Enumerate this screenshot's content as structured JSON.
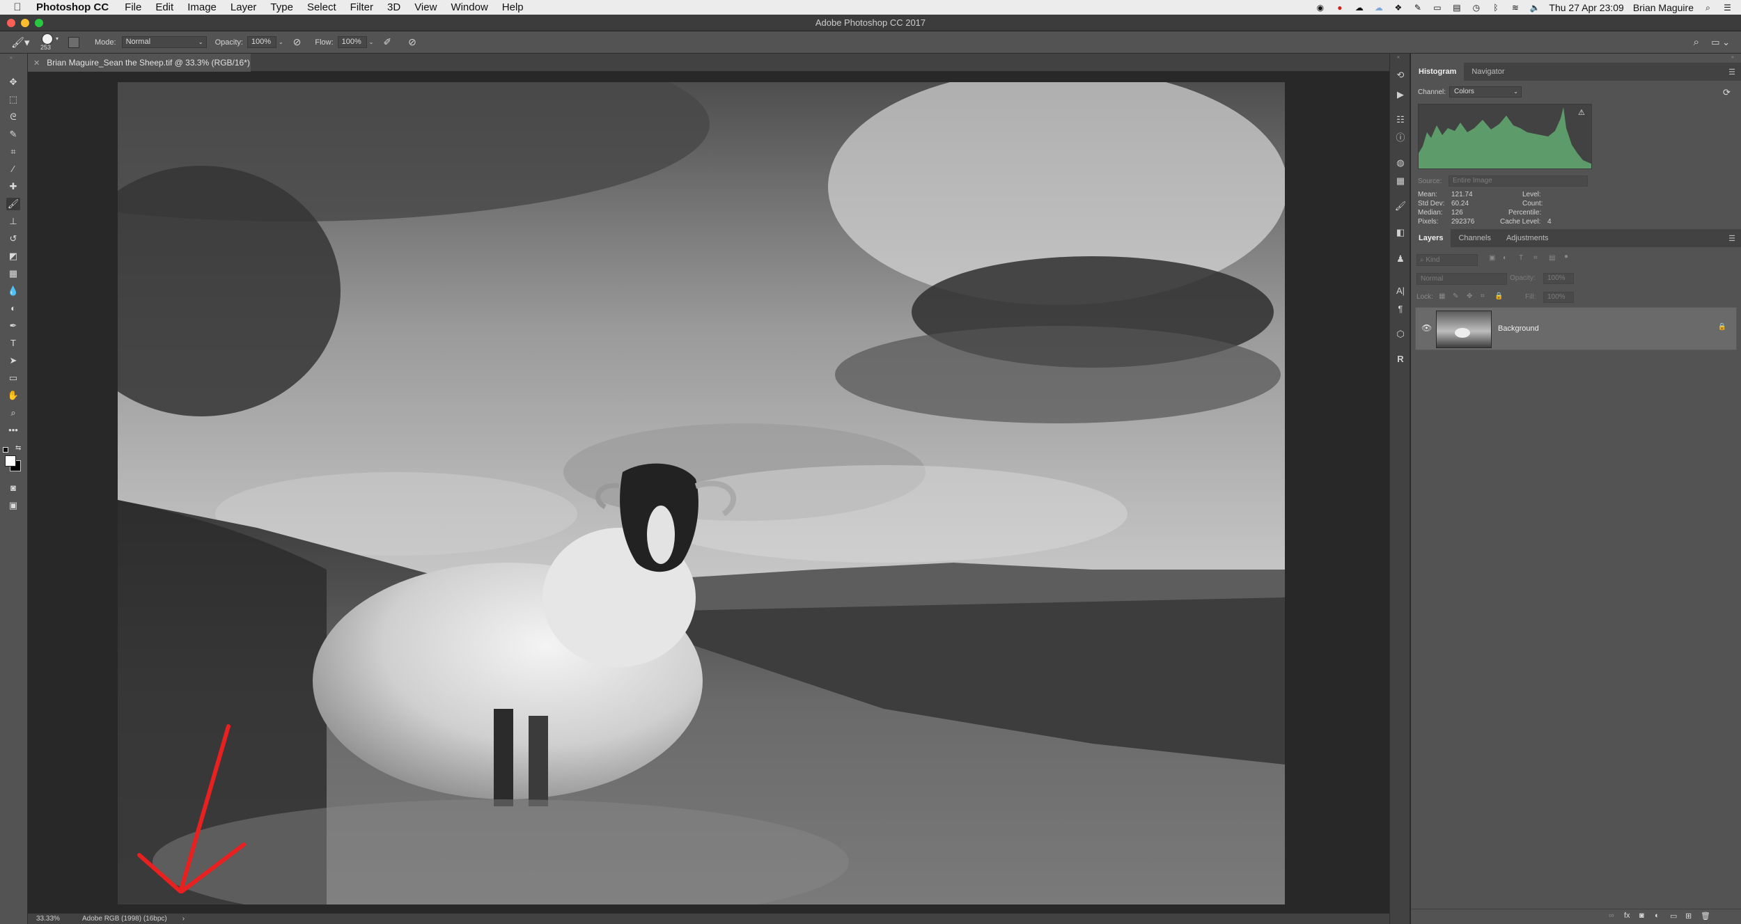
{
  "menubar": {
    "app_name": "Photoshop CC",
    "items": [
      "File",
      "Edit",
      "Image",
      "Layer",
      "Type",
      "Select",
      "Filter",
      "3D",
      "View",
      "Window",
      "Help"
    ],
    "clock": "Thu 27 Apr  23:09",
    "user": "Brian Maguire"
  },
  "window": {
    "title": "Adobe Photoshop CC 2017",
    "traffic_colors": [
      "#fc5f57",
      "#fdbc2e",
      "#28c840"
    ]
  },
  "options": {
    "brush_size": "253",
    "mode_label": "Mode:",
    "mode_value": "Normal",
    "opacity_label": "Opacity:",
    "opacity_value": "100%",
    "flow_label": "Flow:",
    "flow_value": "100%"
  },
  "document": {
    "tab_title": "Brian Maguire_Sean the Sheep.tif @ 33.3% (RGB/16*)",
    "zoom": "33.33%",
    "profile": "Adobe RGB (1998) (16bpc)",
    "status_arrow": "›"
  },
  "histogram": {
    "tabs": [
      "Histogram",
      "Navigator"
    ],
    "channel_label": "Channel:",
    "channel_value": "Colors",
    "source_label": "Source:",
    "source_value": "Entire Image",
    "stats_left": [
      {
        "label": "Mean:",
        "value": "121.74"
      },
      {
        "label": "Std Dev:",
        "value": "60.24"
      },
      {
        "label": "Median:",
        "value": "126"
      },
      {
        "label": "Pixels:",
        "value": "292376"
      }
    ],
    "stats_right": [
      {
        "label": "Level:",
        "value": ""
      },
      {
        "label": "Count:",
        "value": ""
      },
      {
        "label": "Percentile:",
        "value": ""
      },
      {
        "label": "Cache Level:",
        "value": "4"
      }
    ],
    "fill_color": "#5e9b6b"
  },
  "layers": {
    "tabs": [
      "Layers",
      "Channels",
      "Adjustments"
    ],
    "kind_placeholder": "Kind",
    "blend_mode": "Normal",
    "opacity_label": "Opacity:",
    "opacity_value": "100%",
    "lock_label": "Lock:",
    "fill_label": "Fill:",
    "fill_value": "100%",
    "items": [
      {
        "name": "Background",
        "visible": true,
        "locked": true
      }
    ]
  },
  "annotation": {
    "color": "#e8201f"
  }
}
